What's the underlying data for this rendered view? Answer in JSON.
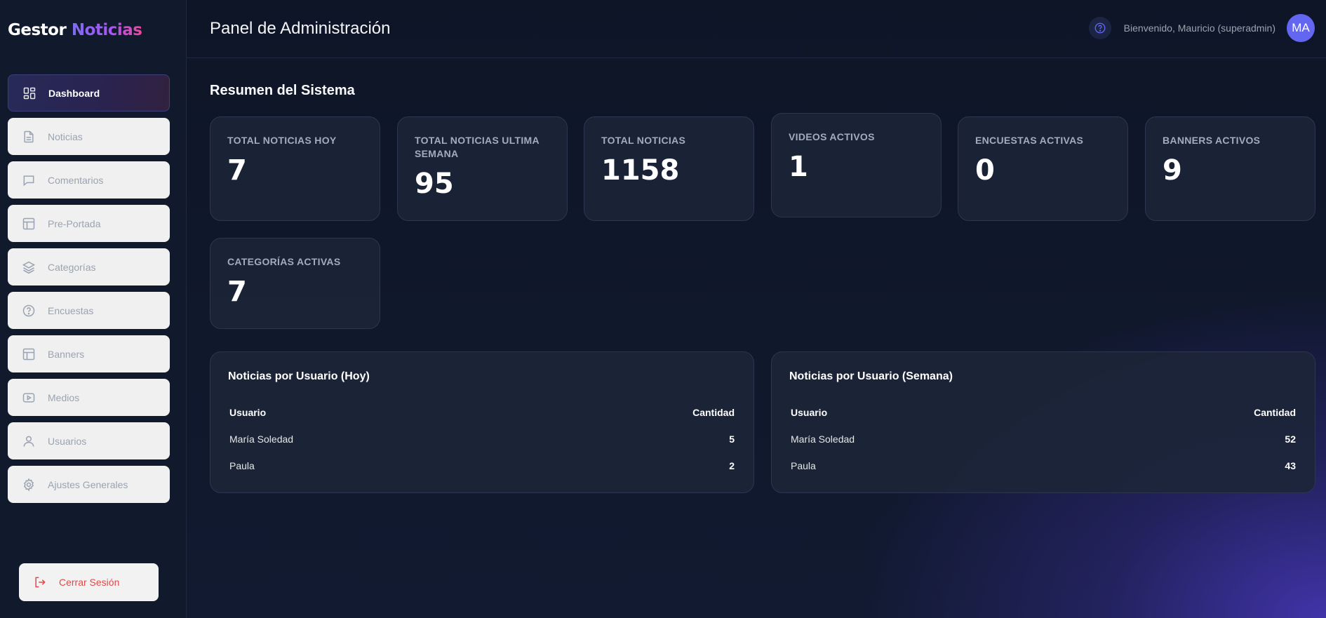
{
  "brand": {
    "part1": "Gestor",
    "part2": "Noticias"
  },
  "sidebar": {
    "items": [
      {
        "label": "Dashboard",
        "icon": "dashboard-icon",
        "active": true
      },
      {
        "label": "Noticias",
        "icon": "file-text-icon"
      },
      {
        "label": "Comentarios",
        "icon": "chat-icon"
      },
      {
        "label": "Pre-Portada",
        "icon": "layout-icon"
      },
      {
        "label": "Categorías",
        "icon": "layers-icon"
      },
      {
        "label": "Encuestas",
        "icon": "help-circle-icon"
      },
      {
        "label": "Banners",
        "icon": "layout-icon"
      },
      {
        "label": "Medios",
        "icon": "video-icon"
      },
      {
        "label": "Usuarios",
        "icon": "user-icon"
      },
      {
        "label": "Ajustes Generales",
        "icon": "gear-icon"
      }
    ],
    "logout_label": "Cerrar Sesión"
  },
  "header": {
    "title": "Panel de Administración",
    "welcome": "Bienvenido, Mauricio (superadmin)",
    "avatar_initials": "MA"
  },
  "summary": {
    "title": "Resumen del Sistema",
    "cards": [
      {
        "label": "TOTAL NOTICIAS HOY",
        "value": "7"
      },
      {
        "label": "TOTAL NOTICIAS ULTIMA SEMANA",
        "value": "95"
      },
      {
        "label": "TOTAL NOTICIAS",
        "value": "1158"
      },
      {
        "label": "VIDEOS ACTIVOS",
        "value": "1"
      },
      {
        "label": "ENCUESTAS ACTIVAS",
        "value": "0"
      },
      {
        "label": "BANNERS ACTIVOS",
        "value": "9"
      },
      {
        "label": "CATEGORÍAS ACTIVAS",
        "value": "7"
      }
    ]
  },
  "tables": [
    {
      "title": "Noticias por Usuario (Hoy)",
      "columns": [
        "Usuario",
        "Cantidad"
      ],
      "rows": [
        [
          "María Soledad",
          "5"
        ],
        [
          "Paula",
          "2"
        ]
      ]
    },
    {
      "title": "Noticias por Usuario (Semana)",
      "columns": [
        "Usuario",
        "Cantidad"
      ],
      "rows": [
        [
          "María Soledad",
          "52"
        ],
        [
          "Paula",
          "43"
        ]
      ]
    }
  ],
  "colors": {
    "accent": "#6366f1",
    "logout": "#e04848",
    "background": "#0f1628"
  }
}
